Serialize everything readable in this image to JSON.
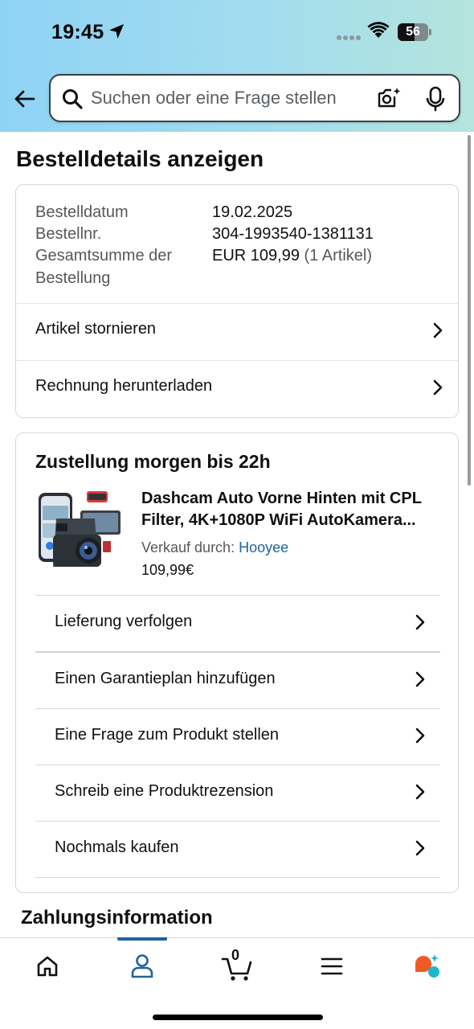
{
  "status_bar": {
    "time": "19:45",
    "battery": "56",
    "battery_level": 0.56
  },
  "search": {
    "placeholder": "Suchen oder eine Frage stellen"
  },
  "page": {
    "title": "Bestelldetails anzeigen"
  },
  "order_summary": {
    "date_label": "Bestelldatum",
    "date_value": "19.02.2025",
    "number_label": "Bestellnr.",
    "number_value": "304-1993540-1381131",
    "total_label_line1": "Gesamtsumme der",
    "total_label_line2": "Bestellung",
    "total_value": "EUR 109,99",
    "total_items": "(1 Artikel)",
    "links": [
      {
        "label": "Artikel stornieren"
      },
      {
        "label": "Rechnung herunterladen"
      }
    ]
  },
  "shipment": {
    "heading": "Zustellung morgen bis 22h",
    "product": {
      "title": "Dashcam Auto Vorne Hinten mit CPL Filter, 4K+1080P WiFi AutoKamera...",
      "seller_prefix": "Verkauf durch:",
      "seller_name": "Hooyee",
      "price": "109,99€"
    },
    "actions": [
      {
        "label": "Lieferung verfolgen"
      },
      {
        "label": "Einen Garantieplan hinzufügen"
      },
      {
        "label": "Eine Frage zum Produkt stellen"
      },
      {
        "label": "Schreib eine Produktrezension"
      },
      {
        "label": "Nochmals kaufen"
      }
    ]
  },
  "payment": {
    "heading": "Zahlungsinformation"
  },
  "tabbar": {
    "cart_count": "0",
    "active_tab": "account",
    "accent_color": "#2162a1",
    "tabs": [
      "home-icon",
      "account-icon",
      "cart-icon",
      "menu-icon",
      "rufus-assistant-icon"
    ]
  }
}
